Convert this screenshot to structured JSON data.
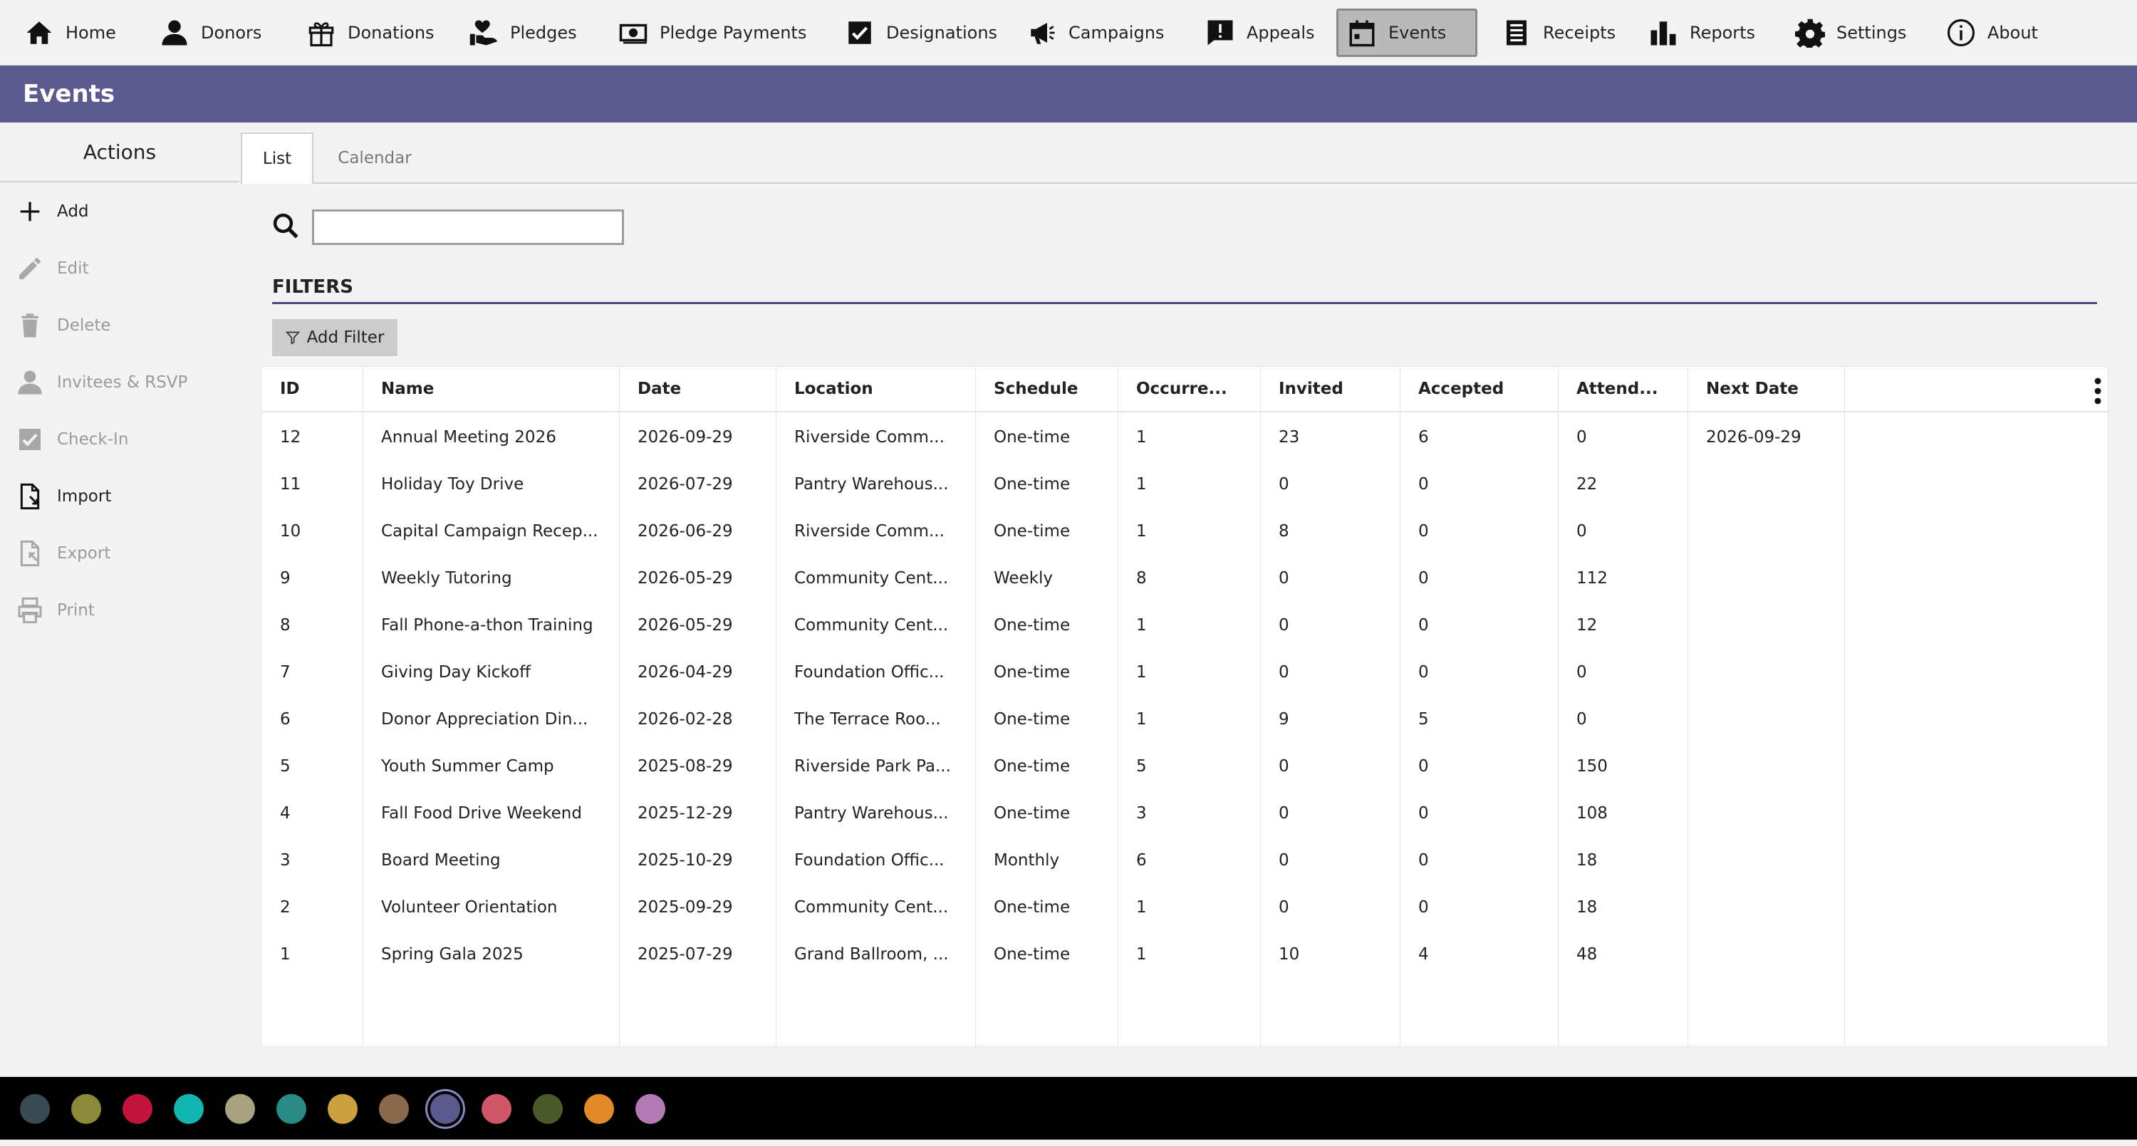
{
  "nav": {
    "items": [
      {
        "label": "Home",
        "icon": "home-icon"
      },
      {
        "label": "Donors",
        "icon": "person-icon"
      },
      {
        "label": "Donations",
        "icon": "gift-icon"
      },
      {
        "label": "Pledges",
        "icon": "hand-heart-icon"
      },
      {
        "label": "Pledge Payments",
        "icon": "money-icon"
      },
      {
        "label": "Designations",
        "icon": "checkbox-icon"
      },
      {
        "label": "Campaigns",
        "icon": "megaphone-icon"
      },
      {
        "label": "Appeals",
        "icon": "alert-message-icon"
      },
      {
        "label": "Events",
        "icon": "calendar-icon",
        "active": true
      },
      {
        "label": "Receipts",
        "icon": "receipt-icon"
      },
      {
        "label": "Reports",
        "icon": "bar-chart-icon"
      },
      {
        "label": "Settings",
        "icon": "gear-icon"
      },
      {
        "label": "About",
        "icon": "info-icon"
      }
    ]
  },
  "header": {
    "title": "Events",
    "color": "#5d5a8d"
  },
  "actions": {
    "title": "Actions",
    "items": [
      {
        "label": "Add",
        "icon": "plus-icon",
        "enabled": true
      },
      {
        "label": "Edit",
        "icon": "pencil-icon",
        "enabled": false
      },
      {
        "label": "Delete",
        "icon": "trash-icon",
        "enabled": false
      },
      {
        "label": "Invitees & RSVP",
        "icon": "person-icon",
        "enabled": false
      },
      {
        "label": "Check-In",
        "icon": "checkbox-icon",
        "enabled": false
      },
      {
        "label": "Import",
        "icon": "file-import-icon",
        "enabled": true
      },
      {
        "label": "Export",
        "icon": "file-export-icon",
        "enabled": false
      },
      {
        "label": "Print",
        "icon": "printer-icon",
        "enabled": false
      }
    ]
  },
  "tabs": [
    {
      "label": "List",
      "active": true
    },
    {
      "label": "Calendar",
      "active": false
    }
  ],
  "search": {
    "value": "",
    "placeholder": ""
  },
  "filters": {
    "title": "FILTERS",
    "add_label": "Add Filter"
  },
  "table": {
    "columns": [
      "ID",
      "Name",
      "Date",
      "Location",
      "Schedule",
      "Occurre...",
      "Invited",
      "Accepted",
      "Attend...",
      "Next Date"
    ],
    "rows": [
      [
        "12",
        "Annual Meeting 2026",
        "2026-09-29",
        "Riverside Comm...",
        "One-time",
        "1",
        "23",
        "6",
        "0",
        "2026-09-29"
      ],
      [
        "11",
        "Holiday Toy Drive",
        "2026-07-29",
        "Pantry Warehous...",
        "One-time",
        "1",
        "0",
        "0",
        "22",
        ""
      ],
      [
        "10",
        "Capital Campaign Recep...",
        "2026-06-29",
        "Riverside Comm...",
        "One-time",
        "1",
        "8",
        "0",
        "0",
        ""
      ],
      [
        "9",
        "Weekly Tutoring",
        "2026-05-29",
        "Community Cent...",
        "Weekly",
        "8",
        "0",
        "0",
        "112",
        ""
      ],
      [
        "8",
        "Fall Phone-a-thon Training",
        "2026-05-29",
        "Community Cent...",
        "One-time",
        "1",
        "0",
        "0",
        "12",
        ""
      ],
      [
        "7",
        "Giving Day Kickoff",
        "2026-04-29",
        "Foundation Offic...",
        "One-time",
        "1",
        "0",
        "0",
        "0",
        ""
      ],
      [
        "6",
        "Donor Appreciation Din...",
        "2026-02-28",
        "The Terrace Roo...",
        "One-time",
        "1",
        "9",
        "5",
        "0",
        ""
      ],
      [
        "5",
        "Youth Summer Camp",
        "2025-08-29",
        "Riverside Park Pa...",
        "One-time",
        "5",
        "0",
        "0",
        "150",
        ""
      ],
      [
        "4",
        "Fall Food Drive Weekend",
        "2025-12-29",
        "Pantry Warehous...",
        "One-time",
        "3",
        "0",
        "0",
        "108",
        ""
      ],
      [
        "3",
        "Board Meeting",
        "2025-10-29",
        "Foundation Offic...",
        "Monthly",
        "6",
        "0",
        "0",
        "18",
        ""
      ],
      [
        "2",
        "Volunteer Orientation",
        "2025-09-29",
        "Community Cent...",
        "One-time",
        "1",
        "0",
        "0",
        "18",
        ""
      ],
      [
        "1",
        "Spring Gala 2025",
        "2025-07-29",
        "Grand Ballroom, ...",
        "One-time",
        "1",
        "10",
        "4",
        "48",
        ""
      ]
    ]
  },
  "theme_colors": [
    {
      "color": "#3a4a52"
    },
    {
      "color": "#8a8a3a"
    },
    {
      "color": "#c0143c"
    },
    {
      "color": "#13b5b1"
    },
    {
      "color": "#a8a280"
    },
    {
      "color": "#2a8a84"
    },
    {
      "color": "#cca040"
    },
    {
      "color": "#8a6a4e"
    },
    {
      "color": "#5d5a8d",
      "selected": true
    },
    {
      "color": "#d0566a"
    },
    {
      "color": "#4a5a2a"
    },
    {
      "color": "#e08a2a"
    },
    {
      "color": "#b27ab2"
    }
  ]
}
